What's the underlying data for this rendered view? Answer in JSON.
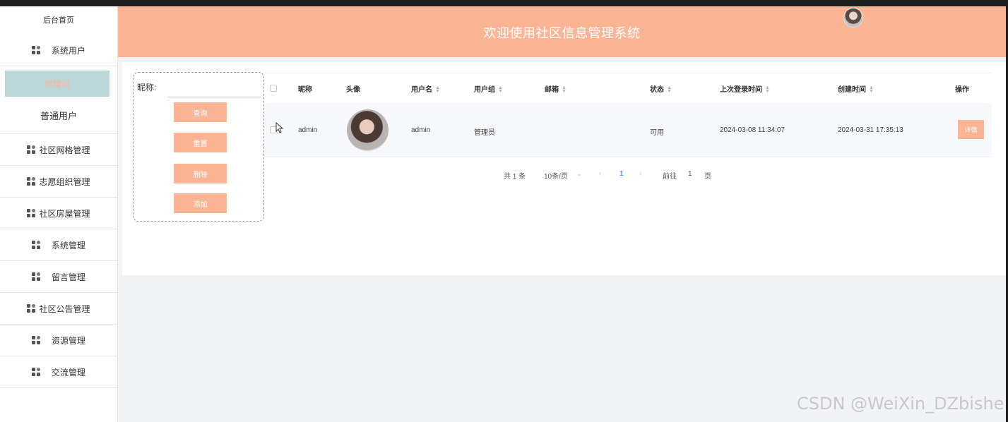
{
  "sidebar": {
    "home": "后台首页",
    "system_users": "系统用户",
    "active_sub": "管理员",
    "sub_normal": "普通用户",
    "items": [
      "社区网格管理",
      "志愿组织管理",
      "社区房屋管理",
      "系统管理",
      "留言管理",
      "社区公告管理",
      "资源管理",
      "交流管理"
    ]
  },
  "header": {
    "title": "欢迎使用社区信息管理系统"
  },
  "search": {
    "label": "昵称:",
    "value": "",
    "buttons": [
      "查询",
      "重置",
      "删除",
      "添加"
    ]
  },
  "table": {
    "headers": [
      "昵称",
      "头像",
      "用户名",
      "用户组",
      "邮箱",
      "状态",
      "上次登录时间",
      "创建时间",
      "操作"
    ],
    "rows": [
      {
        "nickname": "admin",
        "username": "admin",
        "group": "管理员",
        "email": "",
        "status": "可用",
        "last_login": "2024-03-08 11:34:07",
        "created": "2024-03-31 17:35:13",
        "action": "详情"
      }
    ]
  },
  "pagination": {
    "total": "共 1 条",
    "page_size": "10条/页",
    "current": "1",
    "goto_label": "前往",
    "goto_value": "1",
    "page_suffix": "页"
  },
  "watermark": "CSDN @WeiXin_DZbishe",
  "colors": {
    "accent": "#fbb595",
    "active_menu_bg": "#bcd7da",
    "active_menu_text": "#f4b899"
  }
}
